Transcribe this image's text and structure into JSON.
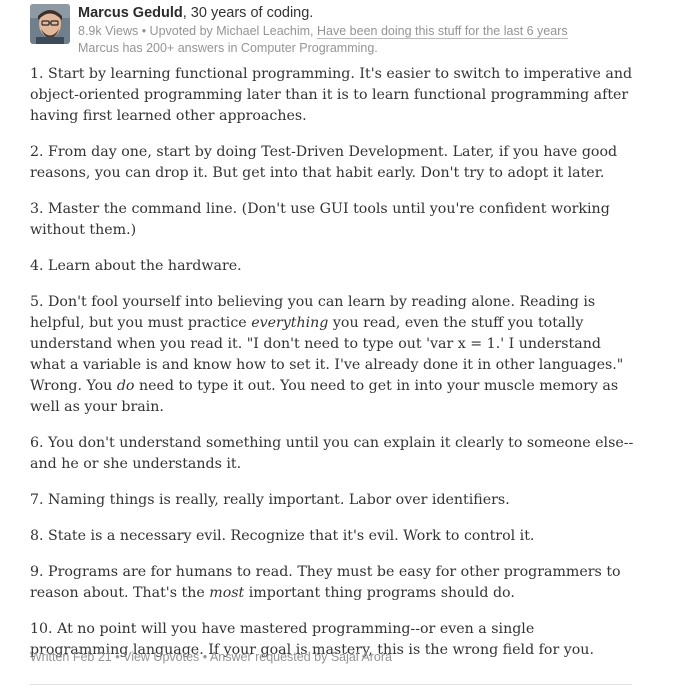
{
  "author": {
    "name": "Marcus Geduld",
    "credential_short": ", 30 years of coding."
  },
  "stats": {
    "views": "8.9k Views",
    "separator": " • ",
    "upvoted_prefix": "Upvoted by ",
    "upvoter": "Michael Leachim, ",
    "upvoter_credential": "Have been doing this stuff for the last 6 years"
  },
  "topic_line": "Marcus has 200+ answers in Computer Programming.",
  "answer": {
    "p1": "1. Start by learning functional programming. It's easier to switch to imperative and object-oriented programming later than it is to learn functional programming after having first learned other approaches.",
    "p2": "2. From day one, start by doing Test-Driven Development. Later, if you have good reasons, you can drop it. But get into that habit early. Don't try to adopt it later.",
    "p3": "3. Master the command line. (Don't use GUI tools until you're confident working without them.)",
    "p4": "4. Learn about the hardware.",
    "p5": {
      "a": "5. Don't fool yourself into believing you can learn by reading alone. Reading is helpful, but you must practice ",
      "b": "everything",
      "c": " you read, even the stuff you totally understand when you read it. \"I don't need to type out 'var x = 1.' I understand what a variable is and know how to set it. I've already done it in other languages.\" Wrong. You ",
      "d": "do",
      "e": " need to type it out. You need to get in into your muscle memory as well as your brain."
    },
    "p6": "6. You don't understand something until you can explain it clearly to someone else--and he or she understands it.",
    "p7": "7. Naming things is really, really important. Labor over identifiers.",
    "p8": "8. State is a necessary evil. Recognize that it's evil. Work to control it.",
    "p9": {
      "a": "9. Programs are for humans to read. They must be easy for other programmers to reason about. That's the ",
      "b": "most",
      "c": " important thing programs should do."
    },
    "p10": "10. At no point will you have mastered programming--or even a single programming language. If your goal is mastery, this is the wrong field for you."
  },
  "footer": {
    "written": "Written Feb 21",
    "sep": " • ",
    "view_upvotes": "View Upvotes",
    "requested": "Answer requested by ",
    "requester": "Sajal Arora"
  },
  "icons": {
    "avatar": "author-avatar-photo"
  }
}
